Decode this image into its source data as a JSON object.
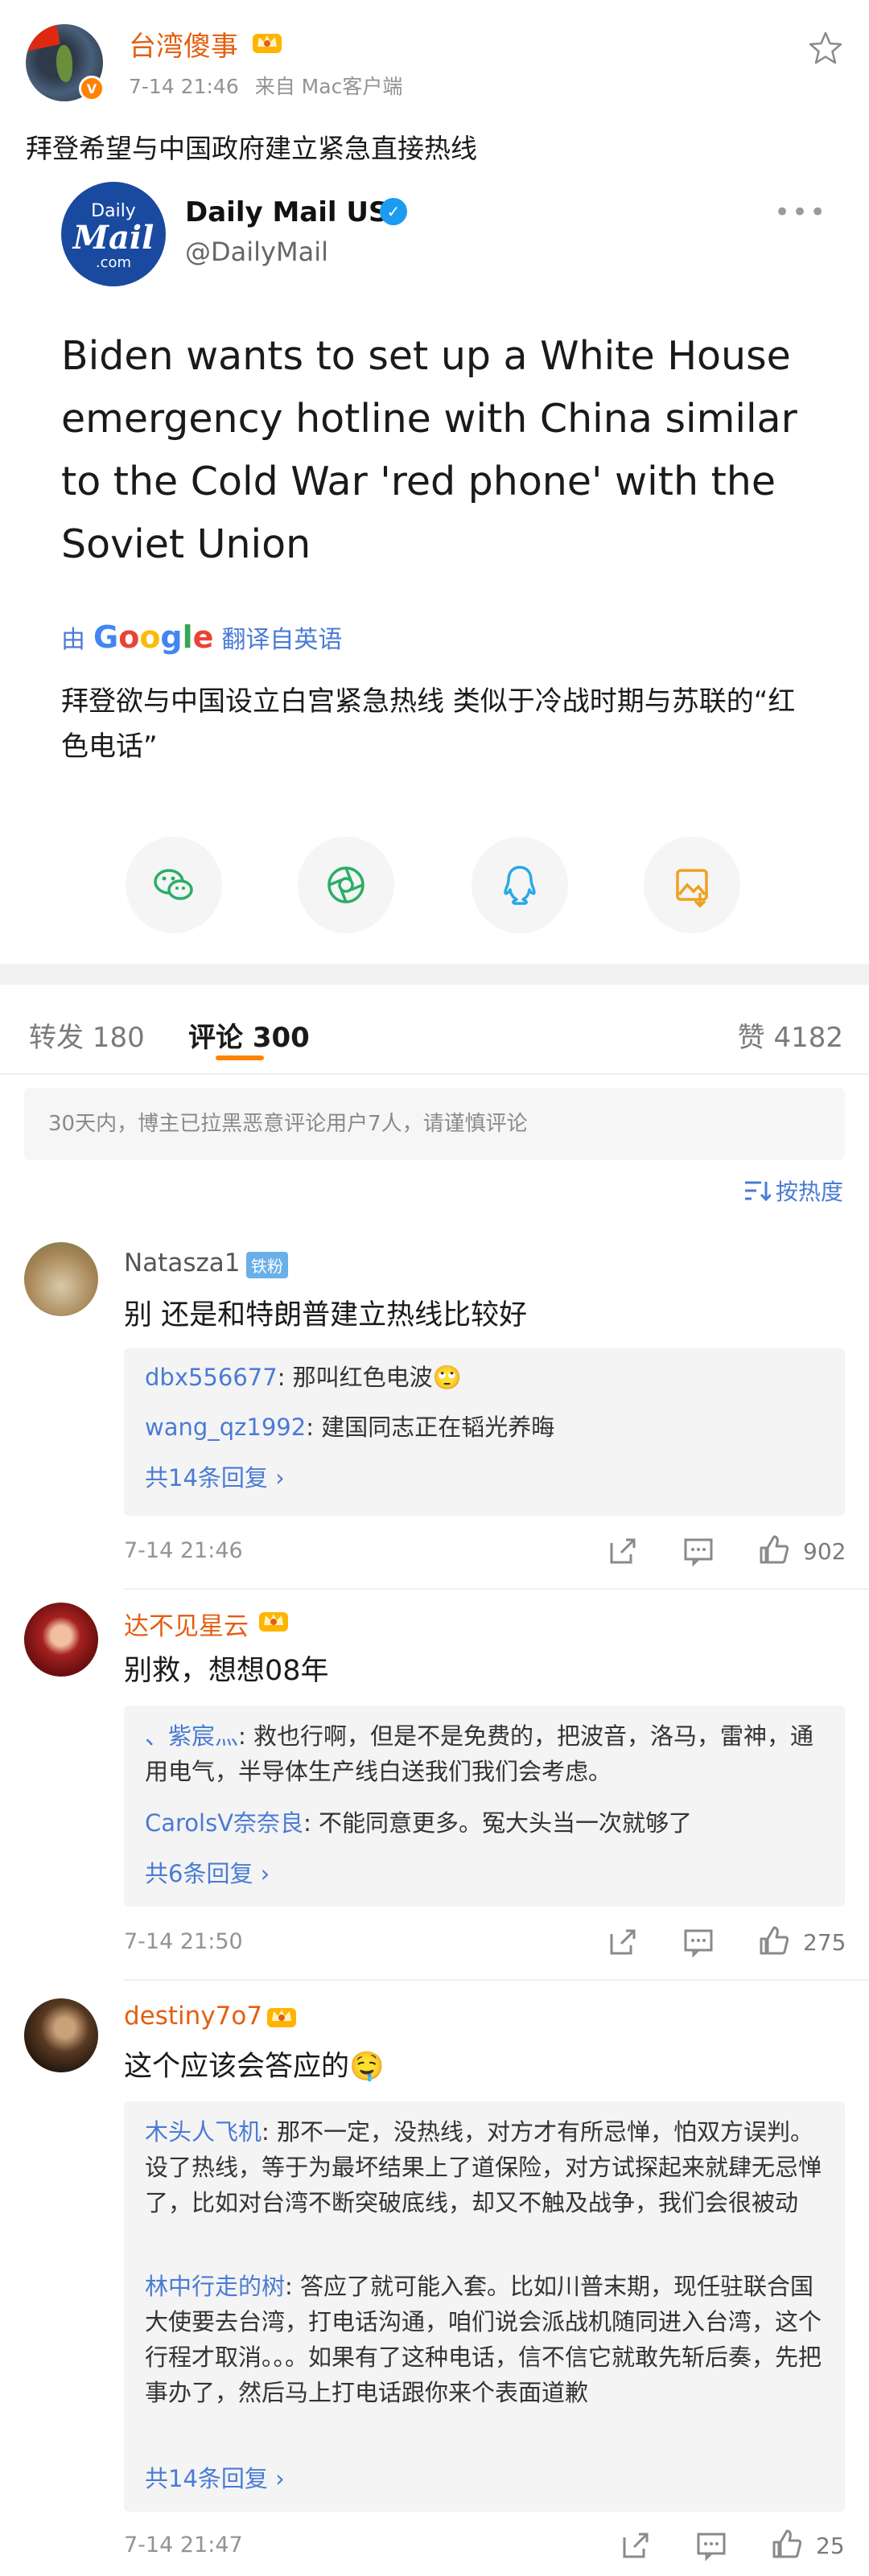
{
  "post": {
    "author": "台湾傻事",
    "time": "7-14 21:46",
    "source": "来自 Mac客户端",
    "text": "拜登希望与中国政府建立紧急直接热线"
  },
  "tweet": {
    "logo_top": "Daily",
    "logo_mid": "Mail",
    "logo_bot": ".com",
    "name": "Daily Mail US",
    "handle": "@DailyMail",
    "more": "•••",
    "body": "Biden wants to set up a White House emergency hotline with China similar to the Cold War 'red phone' with the Soviet Union",
    "translate_prefix": "由",
    "translate_brand": "Google",
    "translate_suffix": "翻译自英语",
    "translated": "拜登欲与中国设立白宫紧急热线 类似于冷战时期与苏联的“红色电话”"
  },
  "share_icons": [
    "wechat-icon",
    "moments-icon",
    "qq-icon",
    "save-image-icon"
  ],
  "tabs": {
    "repost": "转发 180",
    "comments": "评论 300",
    "likes": "赞 4182"
  },
  "notice": "30天内，博主已拉黑恶意评论用户7人，请谨慎评论",
  "sort_label": "按热度",
  "comments": [
    {
      "name": "Natasza1",
      "badge": "铁粉",
      "text": "别 还是和特朗普建立热线比较好",
      "replies": [
        {
          "who": "dbx556677",
          "text": ": 那叫红色电波🙄"
        },
        {
          "who": "wang_qz1992",
          "text": ": 建国同志正在韬光养晦"
        }
      ],
      "more": "共14条回复 ›",
      "time": "7-14 21:46",
      "likes": "902"
    },
    {
      "name": "达不见星云",
      "badge": "",
      "text": "别救，想想08年",
      "replies": [
        {
          "who": "、紫宸灬",
          "text": ": 救也行啊，但是不是免费的，把波音，洛马，雷神，通用电气，半导体生产线白送我们我们会考虑。"
        },
        {
          "who": "CarolsV奈奈良",
          "text": ": 不能同意更多。冤大头当一次就够了"
        }
      ],
      "more": "共6条回复 ›",
      "time": "7-14 21:50",
      "likes": "275"
    },
    {
      "name": "destiny7o7",
      "badge": "",
      "text": "这个应该会答应的🤤",
      "replies": [
        {
          "who": "木头人飞机",
          "text": ": 那不一定，没热线，对方才有所忌惮，怕双方误判。设了热线，等于为最坏结果上了道保险，对方试探起来就肆无忌惮了，比如对台湾不断突破底线，却又不触及战争，我们会很被动"
        },
        {
          "who": "林中行走的树",
          "text": ": 答应了就可能入套。比如川普末期，现任驻联合国大使要去台湾，打电话沟通，咱们说会派战机随同进入台湾，这个行程才取消。。。如果有了这种电话，信不信它就敢先斩后奏，先把事办了，然后马上打电话跟你来个表面道歉"
        }
      ],
      "more": "共14条回复 ›",
      "time": "7-14 21:47",
      "likes": "25"
    }
  ],
  "colors": {
    "accent_orange": "#ff8200",
    "link_blue": "#4a7bd4",
    "username_orange": "#e35f12"
  }
}
